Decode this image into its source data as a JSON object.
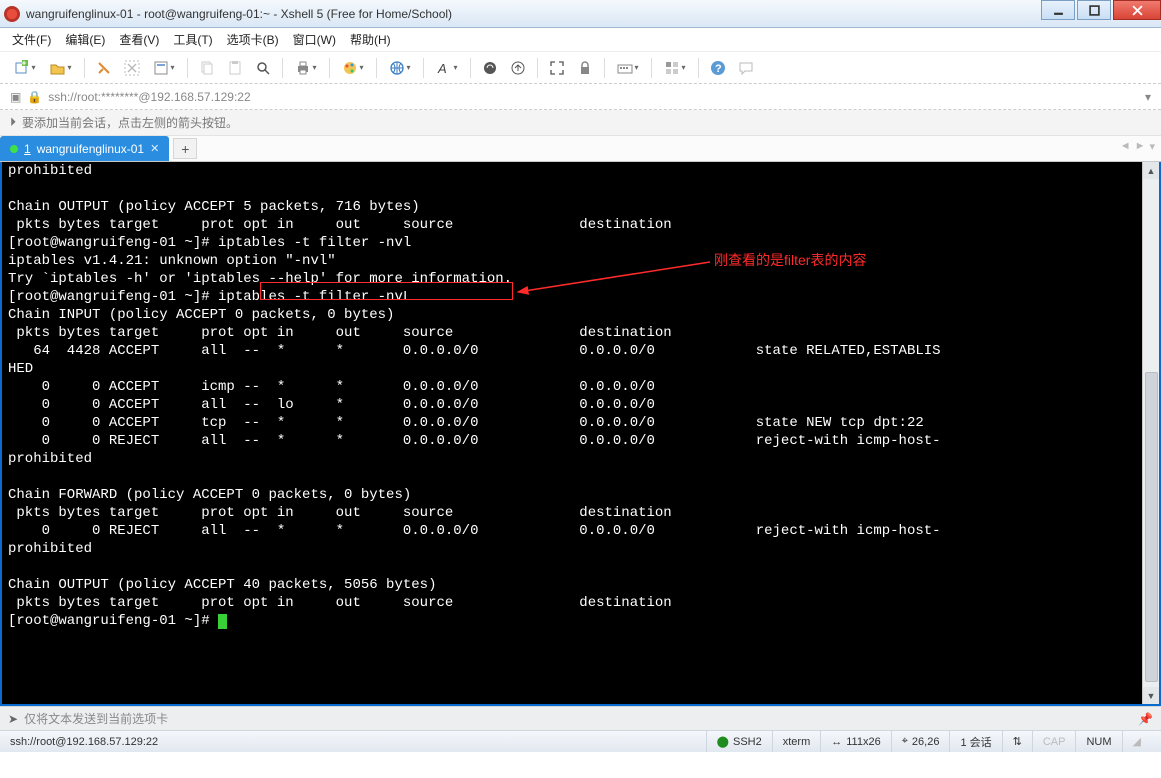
{
  "window": {
    "title": "wangruifenglinux-01 - root@wangruifeng-01:~ - Xshell 5 (Free for Home/School)"
  },
  "menu": {
    "file": "文件(F)",
    "edit": "编辑(E)",
    "view": "查看(V)",
    "tools": "工具(T)",
    "tabs": "选项卡(B)",
    "window": "窗口(W)",
    "help": "帮助(H)"
  },
  "address": {
    "value": "ssh://root:********@192.168.57.129:22"
  },
  "hint": {
    "text": "要添加当前会话，点击左侧的箭头按钮。"
  },
  "tab": {
    "index": "1",
    "label": "wangruifenglinux-01"
  },
  "annotation": {
    "text": "刚查看的是filter表的内容"
  },
  "term": {
    "l1": "prohibited",
    "l2": "",
    "l3": "Chain OUTPUT (policy ACCEPT 5 packets, 716 bytes)",
    "l4": " pkts bytes target     prot opt in     out     source               destination",
    "l5": "[root@wangruifeng-01 ~]# iptables -t filter -nvl",
    "l6": "iptables v1.4.21: unknown option \"-nvl\"",
    "l7": "Try `iptables -h' or 'iptables --help' for more information.",
    "l8": "[root@wangruifeng-01 ~]# iptables -t filter -nvL",
    "l9": "Chain INPUT (policy ACCEPT 0 packets, 0 bytes)",
    "l10": " pkts bytes target     prot opt in     out     source               destination",
    "l11a": "   64  4428 ACCEPT     all  --  *      *       0.0.0.0/0            0.0.0.0/0            state RELATED,ESTABLIS",
    "l11b": "HED",
    "l12": "    0     0 ACCEPT     icmp --  *      *       0.0.0.0/0            0.0.0.0/0",
    "l13": "    0     0 ACCEPT     all  --  lo     *       0.0.0.0/0            0.0.0.0/0",
    "l14": "    0     0 ACCEPT     tcp  --  *      *       0.0.0.0/0            0.0.0.0/0            state NEW tcp dpt:22",
    "l15a": "    0     0 REJECT     all  --  *      *       0.0.0.0/0            0.0.0.0/0            reject-with icmp-host-",
    "l15b": "prohibited",
    "l16": "",
    "l17": "Chain FORWARD (policy ACCEPT 0 packets, 0 bytes)",
    "l18": " pkts bytes target     prot opt in     out     source               destination",
    "l19a": "    0     0 REJECT     all  --  *      *       0.0.0.0/0            0.0.0.0/0            reject-with icmp-host-",
    "l19b": "prohibited",
    "l20": "",
    "l21": "Chain OUTPUT (policy ACCEPT 40 packets, 5056 bytes)",
    "l22": " pkts bytes target     prot opt in     out     source               destination",
    "l23": "[root@wangruifeng-01 ~]# "
  },
  "inputbar": {
    "placeholder": "仅将文本发送到当前选项卡"
  },
  "status": {
    "conn": "ssh://root@192.168.57.129:22",
    "ssh": "SSH2",
    "term": "xterm",
    "size": "111x26",
    "pos": "26,26",
    "sess": "1 会话",
    "cap": "CAP",
    "num": "NUM",
    "arrows": "⇅"
  }
}
